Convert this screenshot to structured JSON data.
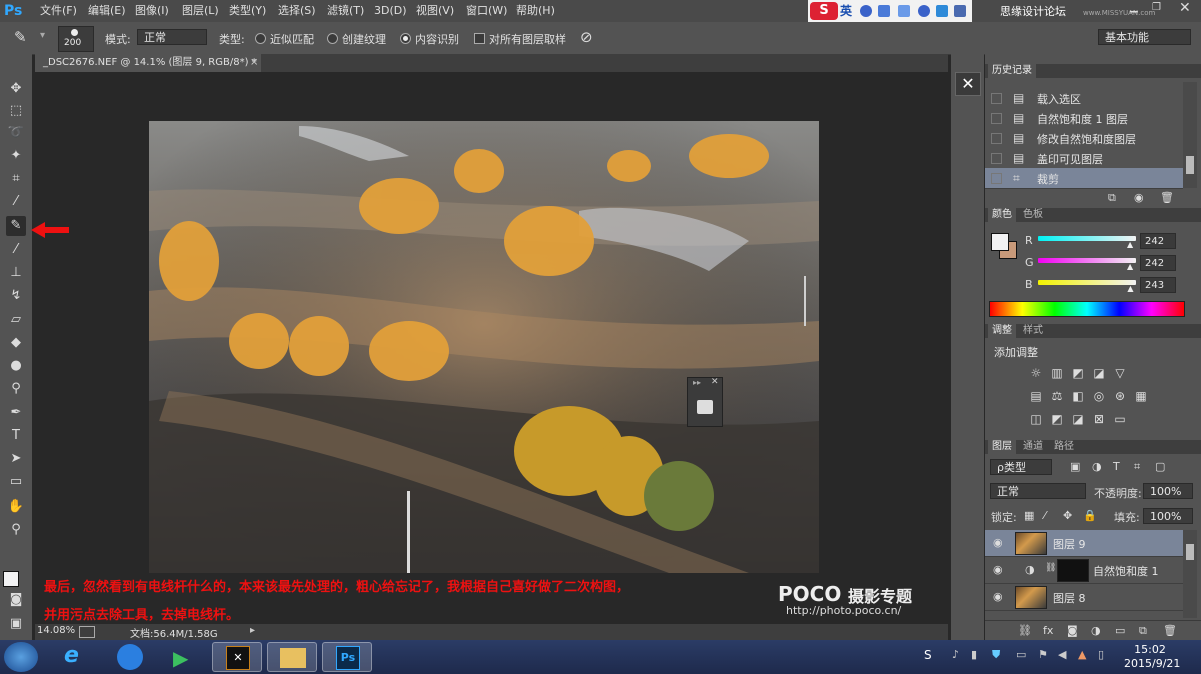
{
  "app": {
    "logo": "Ps"
  },
  "menu": [
    "文件(F)",
    "编辑(E)",
    "图像(I)",
    "图层(L)",
    "类型(Y)",
    "选择(S)",
    "滤镜(T)",
    "3D(D)",
    "视图(V)",
    "窗口(W)",
    "帮助(H)"
  ],
  "ime": {
    "logo": "S",
    "mode": "英"
  },
  "watermark_brand": "思缘设计论坛",
  "watermark_url": "www.MISSYUAN.com",
  "options": {
    "brush_size": "200",
    "mode_label": "模式:",
    "mode_value": "正常",
    "type_label": "类型:",
    "radio1": "近似匹配",
    "radio2": "创建纹理",
    "radio3": "内容识别",
    "sample_all": "对所有图层取样",
    "workspace": "基本功能"
  },
  "document": {
    "tab": "_DSC2676.NEF @ 14.1% (图层 9, RGB/8*) *",
    "zoom": "14.08%",
    "doc_size": "文档:56.4M/1.58G"
  },
  "caption": {
    "line1": "最后，忽然看到有电线杆什么的，本来该最先处理的，粗心给忘记了，我根据自己喜好做了二次构图，",
    "line2": "并用污点去除工具，去掉电线杆。"
  },
  "poco": {
    "brand": "POCO",
    "title": "摄影专题",
    "url": "http://photo.poco.cn/"
  },
  "history": {
    "tab": "历史记录",
    "items": [
      {
        "label": "载入选区",
        "icon": "document-icon"
      },
      {
        "label": "自然饱和度 1 图层",
        "icon": "document-icon"
      },
      {
        "label": "修改自然饱和度图层",
        "icon": "document-icon"
      },
      {
        "label": "盖印可见图层",
        "icon": "document-icon"
      },
      {
        "label": "裁剪",
        "icon": "crop-icon"
      }
    ]
  },
  "color_panel": {
    "tabs": [
      "颜色",
      "色板"
    ],
    "r_label": "R",
    "g_label": "G",
    "b_label": "B",
    "r": "242",
    "g": "242",
    "b": "243",
    "r_fraction": 0.949,
    "g_fraction": 0.949,
    "b_fraction": 0.953
  },
  "adjust_panel": {
    "tabs": [
      "调整",
      "样式"
    ],
    "title": "添加调整"
  },
  "layers_panel": {
    "tabs": [
      "图层",
      "通道",
      "路径"
    ],
    "filter": "ρ类型",
    "blend": "正常",
    "opacity_label": "不透明度:",
    "opacity": "100%",
    "lock_label": "锁定:",
    "fill_label": "填充:",
    "fill": "100%",
    "layers": [
      {
        "name": "图层 9",
        "selected": true
      },
      {
        "name": "自然饱和度 1",
        "selected": false
      },
      {
        "name": "图层 8",
        "selected": false
      }
    ]
  },
  "taskbar": {
    "time": "15:02",
    "date": "2015/9/21"
  },
  "colors": {
    "ui_dark": "#535353",
    "canvas": "#282828",
    "caption_red": "#e11111",
    "selected_row": "#7a8599"
  }
}
